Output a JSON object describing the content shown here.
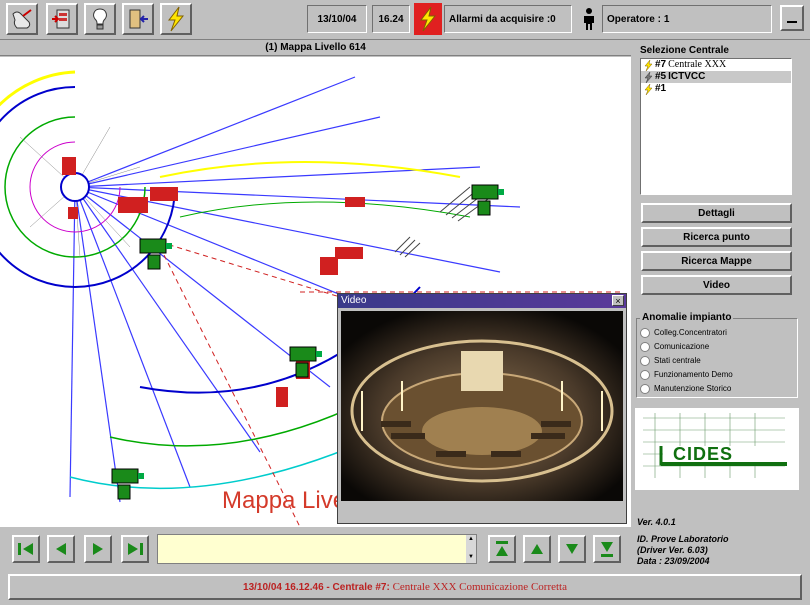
{
  "toolbar": {
    "date": "13/10/04",
    "time": "16.24",
    "alarm_label": "Allarmi da acquisire :",
    "alarm_count": "0",
    "operator_label": "Operatore :",
    "operator_value": "1",
    "buttons": [
      "logout-icon",
      "panel-icon",
      "lightbulb-icon",
      "exit-door-icon",
      "lightning-icon"
    ]
  },
  "map": {
    "title": "(1) Mappa Livello 614",
    "caption": "Mappa Live"
  },
  "video": {
    "title": "Video",
    "close": "×"
  },
  "centrale": {
    "label": "Selezione Centrale",
    "items": [
      {
        "prefix": "#7",
        "name": "Centrale XXX"
      },
      {
        "prefix": "#5",
        "name": "ICTVCC"
      },
      {
        "prefix": "#1",
        "name": ""
      }
    ]
  },
  "buttons": {
    "dettagli": "Dettagli",
    "ricerca_punto": "Ricerca punto",
    "ricerca_mappe": "Ricerca Mappe",
    "video": "Video"
  },
  "anomalie": {
    "label": "Anomalie impianto",
    "items": [
      "Colleg.Concentratori",
      "Comunicazione",
      "Stati centrale",
      "Funzionamento Demo",
      "Manutenzione Storico"
    ]
  },
  "logo": {
    "text": "CIDES"
  },
  "info": {
    "version": "Ver. 4.0.1",
    "id": "ID. Prove Laboratorio",
    "driver": "(Driver Ver. 6.03)",
    "date": "Data : 23/09/2004"
  },
  "status": {
    "prefix": "13/10/04 16.12.46 - Centrale #7:",
    "message": "Centrale XXX Comunicazione Corretta"
  }
}
